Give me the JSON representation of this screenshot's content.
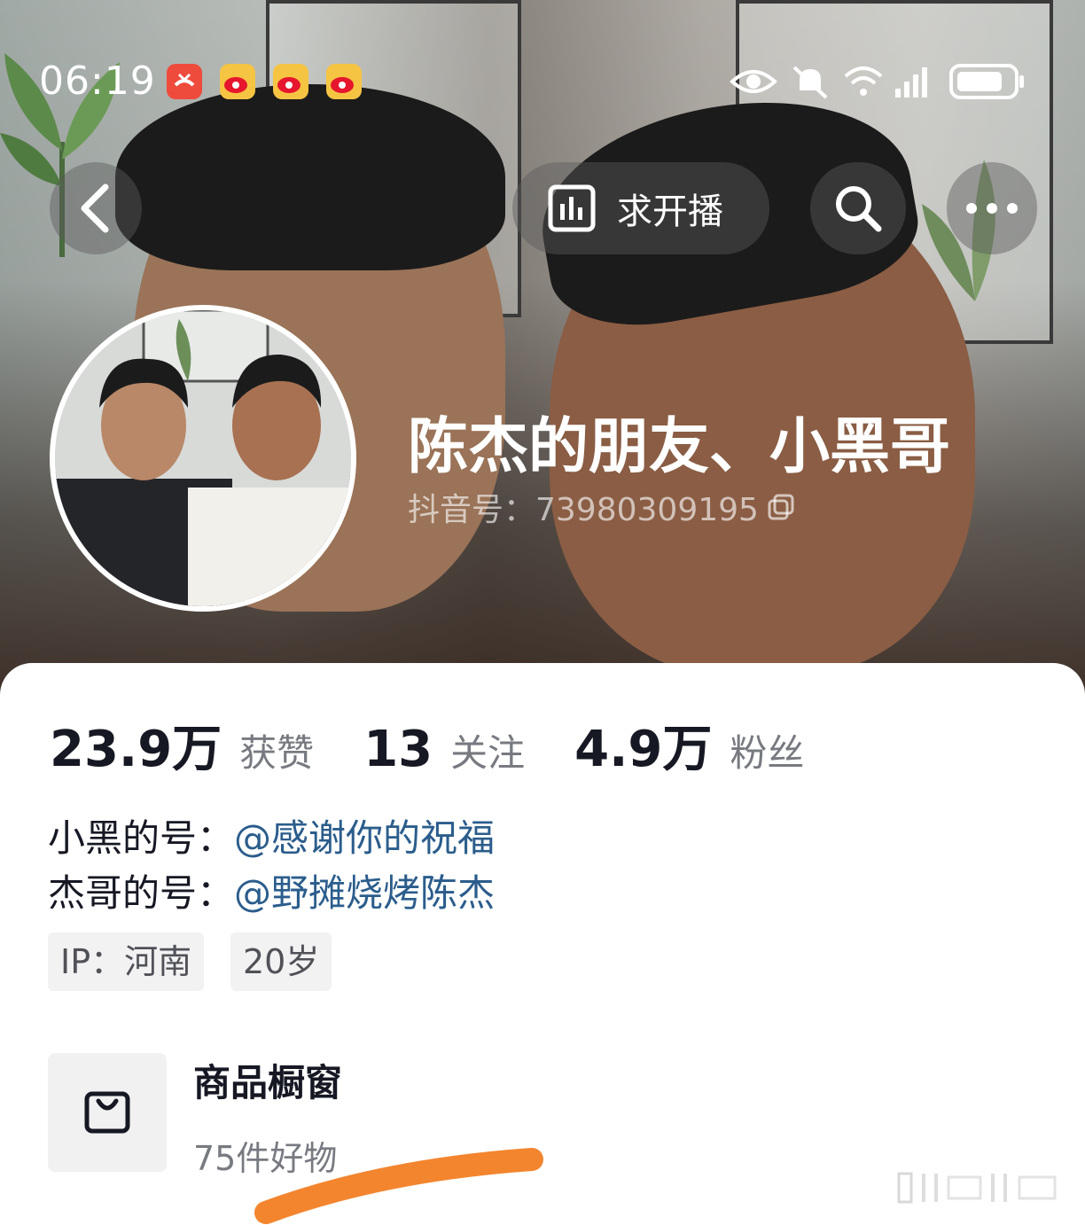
{
  "status_bar": {
    "time": "06:19"
  },
  "nav": {
    "center_label": "求开播",
    "icons": [
      "back-icon",
      "chart-icon",
      "search-icon",
      "more-icon"
    ]
  },
  "profile": {
    "name": "陈杰的朋友、小黑哥",
    "douyin_id_label": "抖音号：73980309195"
  },
  "stats": [
    {
      "value": "23.9万",
      "label": "获赞"
    },
    {
      "value": "13",
      "label": "关注"
    },
    {
      "value": "4.9万",
      "label": "粉丝"
    }
  ],
  "bio": [
    {
      "prefix": "小黑的号：",
      "link": "@感谢你的祝福"
    },
    {
      "prefix": "杰哥的号：",
      "link": "@野摊烧烤陈杰"
    }
  ],
  "tags": [
    "IP：河南",
    "20岁"
  ],
  "shop": {
    "title": "商品橱窗",
    "subtitle": "75件好物"
  },
  "colors": {
    "link": "#2b5d8c",
    "highlight_stroke": "#f3852e",
    "text_primary": "#161823",
    "text_secondary": "#777a80"
  }
}
